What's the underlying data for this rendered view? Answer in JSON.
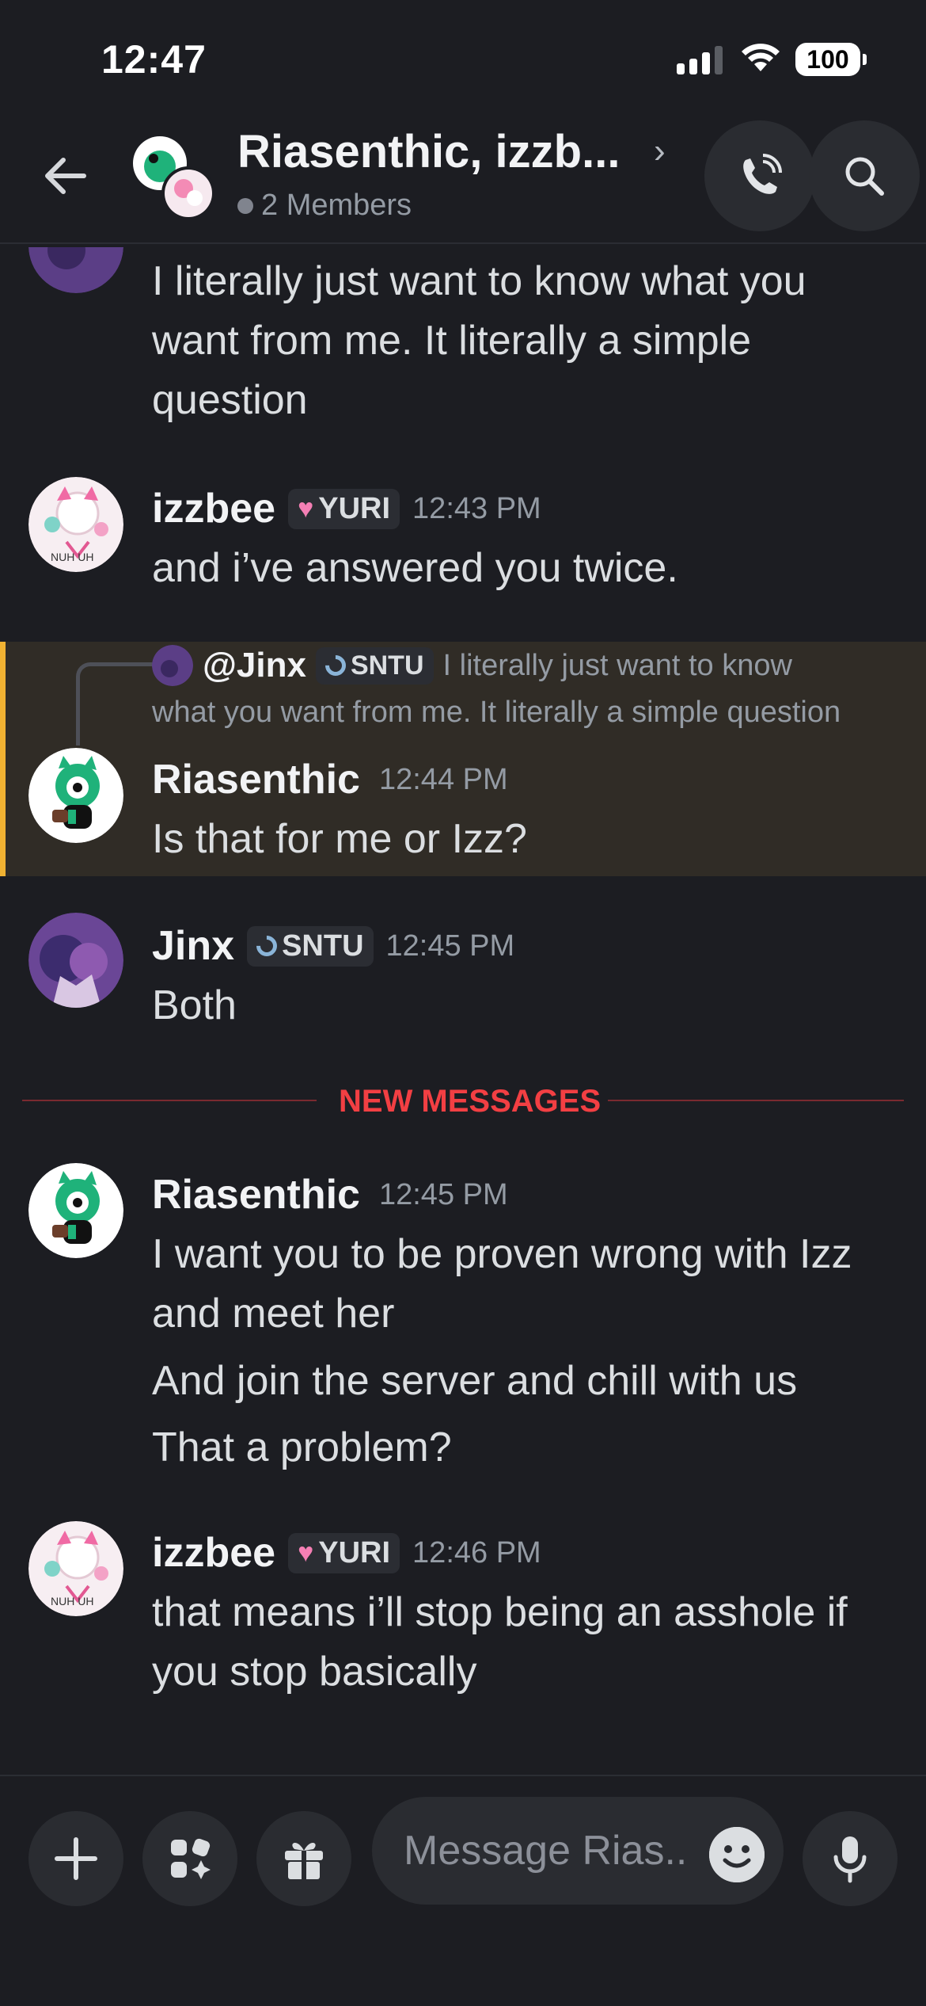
{
  "status_bar": {
    "time": "12:47",
    "battery": "100"
  },
  "header": {
    "title": "Riasenthic, izzb...",
    "members": "2 Members"
  },
  "messages": {
    "top_fragment": {
      "lines": [
        "I literally just want to know what you",
        "want from me. It literally a simple",
        "question"
      ]
    },
    "m1": {
      "user": "izzbee",
      "tag": "YURI",
      "time": "12:43 PM",
      "text": "and i’ve answered you twice."
    },
    "m2": {
      "reply_user": "@Jinx",
      "reply_tag": "SNTU",
      "reply_text_1": "I literally just want to know",
      "reply_text_2": "what you want from me. It literally a simple question",
      "user": "Riasenthic",
      "time": "12:44 PM",
      "text": "Is that for me or Izz?"
    },
    "m3": {
      "user": "Jinx",
      "tag": "SNTU",
      "time": "12:45 PM",
      "text": "Both"
    },
    "divider": "NEW MESSAGES",
    "m4": {
      "user": "Riasenthic",
      "time": "12:45 PM",
      "line1": "I want you to be proven wrong with Izz",
      "line2": "and meet her",
      "line3": "And join the server and chill with us",
      "line4": "That a problem?"
    },
    "m5": {
      "user": "izzbee",
      "tag": "YURI",
      "time": "12:46 PM",
      "line1": "that means i’ll stop being an asshole if",
      "line2": "you stop basically"
    }
  },
  "composer": {
    "placeholder": "Message Rias..."
  },
  "colors": {
    "background": "#1c1d22",
    "highlight": "#302c26",
    "highlight_bar": "#f0b232",
    "new_messages": "#f23f43"
  },
  "icons": [
    "back-arrow-icon",
    "call-icon",
    "search-icon",
    "plus-icon",
    "apps-icon",
    "gift-icon",
    "emoji-icon",
    "microphone-icon"
  ]
}
